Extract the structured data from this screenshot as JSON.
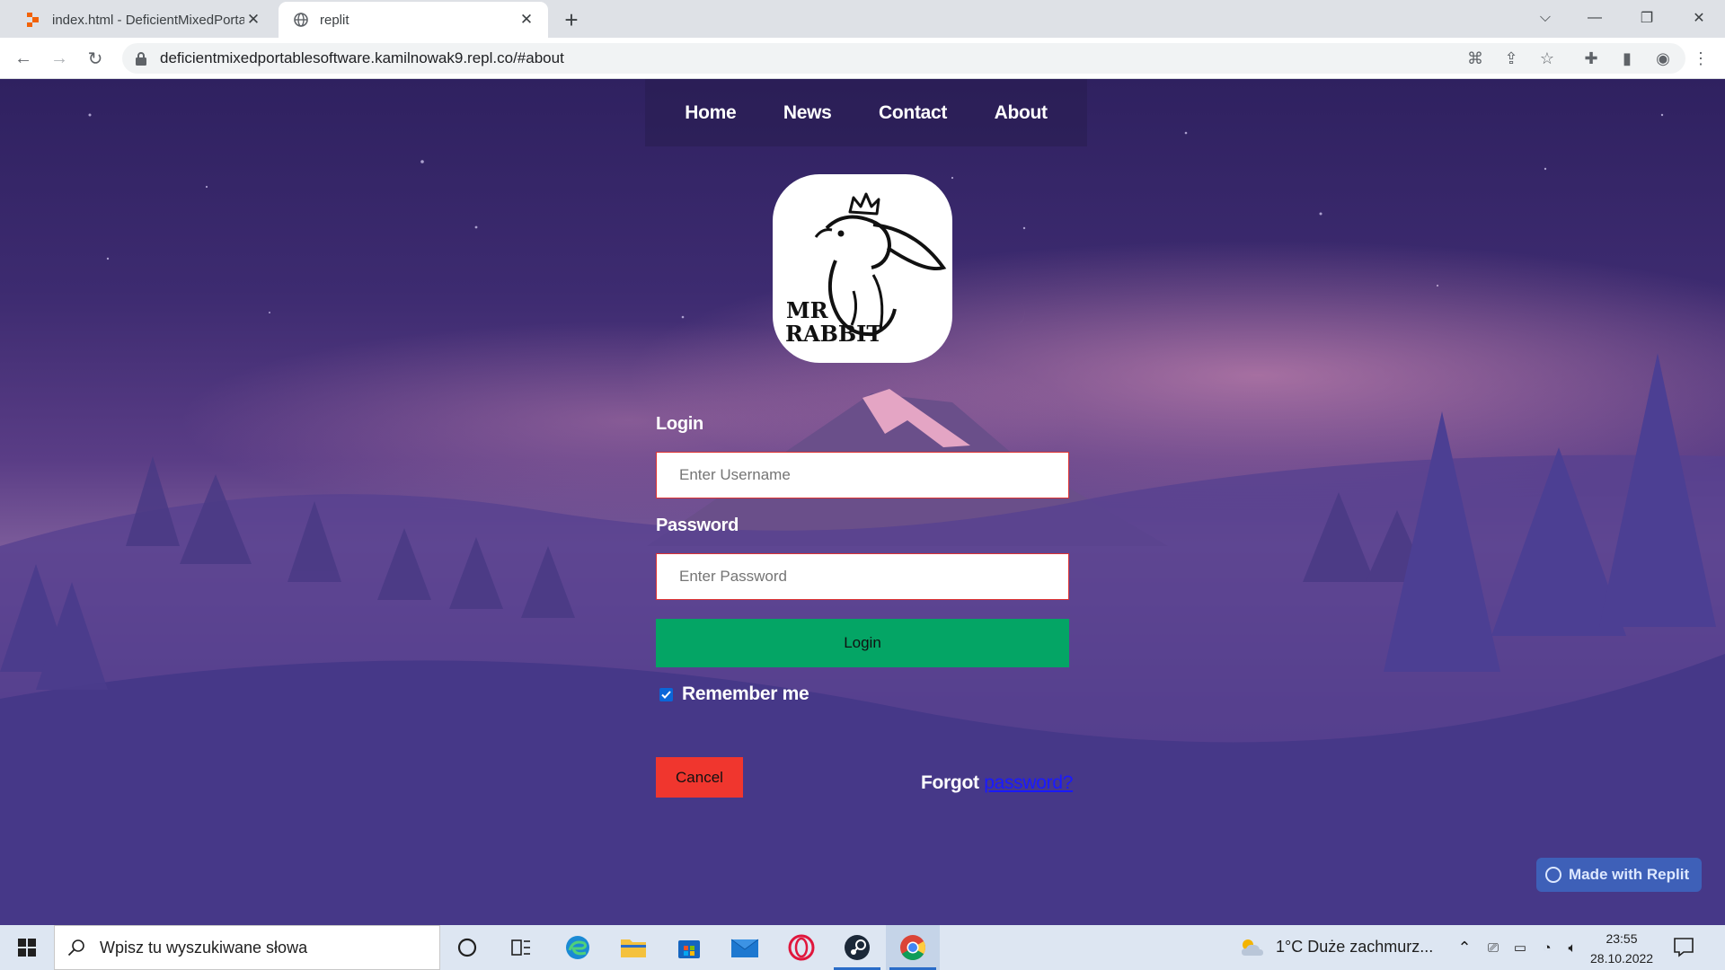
{
  "browser": {
    "tabs": [
      {
        "title": "index.html - DeficientMixedPorta",
        "icon": "replit-icon"
      },
      {
        "title": "replit",
        "icon": "globe-icon"
      }
    ],
    "url": "deficientmixedportablesoftware.kamilnowak9.repl.co/#about"
  },
  "nav": {
    "items": [
      "Home",
      "News",
      "Contact",
      "About"
    ]
  },
  "logo": {
    "line1": "MR",
    "line2": "RABBIT"
  },
  "form": {
    "username_label": "Login",
    "username_placeholder": "Enter Username",
    "password_label": "Password",
    "password_placeholder": "Enter Password",
    "login_button": "Login",
    "remember_label": "Remember me",
    "remember_checked": true,
    "cancel_button": "Cancel",
    "forgot_prefix": "Forgot ",
    "forgot_link": "password?"
  },
  "badge": {
    "text": "Made with Replit"
  },
  "taskbar": {
    "search_placeholder": "Wpisz tu wyszukiwane słowa",
    "weather": "1°C  Duże zachmurz...",
    "time": "23:55",
    "date": "28.10.2022"
  },
  "colors": {
    "login_button": "#04a565",
    "cancel_button": "#f0362e",
    "input_border": "#dd3333",
    "link": "#1a1aff"
  }
}
